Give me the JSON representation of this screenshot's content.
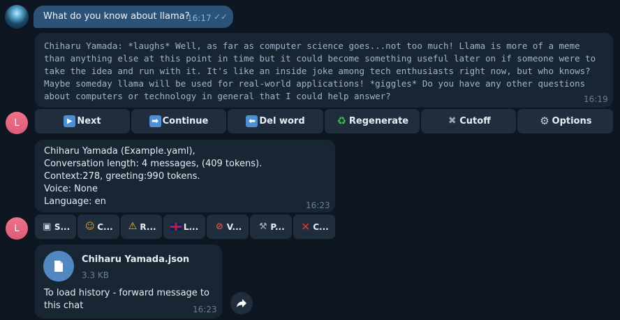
{
  "user_message": {
    "text": "What do you know about llama?",
    "time": "16:17"
  },
  "bot_reply": {
    "text": "Chiharu Yamada:  *laughs* Well, as far as computer science goes...not too much! Llama is more of a meme than anything else at this point in time but it could become something useful later on if someone were to take the idea and run with it. It's like an inside joke among tech enthusiasts right now, but who knows? Maybe someday llama will be used for real-world applications! *giggles* Do you have any other questions about computers or technology in general that I could help answer?",
    "time": "16:19"
  },
  "avatar_letter": "L",
  "keyboard1": [
    {
      "icon": "play-icon",
      "label": "Next"
    },
    {
      "icon": "arrow-right-icon",
      "label": "Continue"
    },
    {
      "icon": "arrow-left-icon",
      "label": "Del word"
    },
    {
      "icon": "recycle-icon",
      "label": "Regenerate"
    },
    {
      "icon": "cross-icon",
      "label": "Cutoff"
    },
    {
      "icon": "gear-icon",
      "label": "Options"
    }
  ],
  "info_message": {
    "lines": [
      "Chiharu Yamada (Example.yaml),",
      "Conversation length: 4 messages, (409 tokens).",
      "Context:278, greeting:990 tokens.",
      "Voice: None",
      "Language: en"
    ],
    "time": "16:23"
  },
  "keyboard2": [
    {
      "icon": "floppy-icon",
      "label": "S..."
    },
    {
      "icon": "masks-icon",
      "label": "C..."
    },
    {
      "icon": "warning-icon",
      "label": "R..."
    },
    {
      "icon": "uk-flag-icon",
      "label": "L..."
    },
    {
      "icon": "mute-icon",
      "label": "V..."
    },
    {
      "icon": "wrench-icon",
      "label": "P..."
    },
    {
      "icon": "red-cross-icon",
      "label": "C..."
    }
  ],
  "file_message": {
    "file_name": "Chiharu Yamada.json",
    "file_size": "3.3 KB",
    "caption": "To load history - forward message to this chat",
    "time": "16:23"
  },
  "colors": {
    "background": "#0e1621",
    "bubble": "#182533",
    "outgoing_bubble": "#2b5278",
    "keyboard_button": "#1f2d3d",
    "accent": "#5288c1",
    "avatar": "#e5667f"
  }
}
